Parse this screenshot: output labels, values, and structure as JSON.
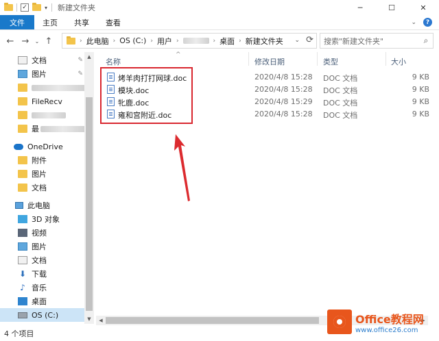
{
  "window": {
    "title": "新建文件夹",
    "minimize": "─",
    "maximize": "☐",
    "close": "✕"
  },
  "ribbon": {
    "tabs": [
      "文件",
      "主页",
      "共享",
      "查看"
    ],
    "expand": "⌄",
    "help": "?"
  },
  "nav": {
    "back": "←",
    "forward": "→",
    "recent": "⌄",
    "up": "↑",
    "breadcrumb": [
      "此电脑",
      "OS (C:)",
      "用户",
      "桌面",
      "新建文件夹"
    ],
    "refresh": "⟳",
    "search_placeholder": "搜索\"新建文件夹\"",
    "search_icon": "⌕"
  },
  "sidebar": {
    "quick_access": [
      {
        "label": "文档",
        "icon": "documents-icon",
        "pinned": true
      },
      {
        "label": "图片",
        "icon": "pictures-icon",
        "pinned": true
      },
      {
        "label": "",
        "icon": "folder-icon",
        "blurred": true
      },
      {
        "label": "FileRecv",
        "icon": "folder-icon"
      },
      {
        "label": "",
        "icon": "folder-icon",
        "blurred": true
      },
      {
        "label": "最",
        "icon": "folder-icon",
        "blurred": true
      }
    ],
    "onedrive": {
      "label": "OneDrive",
      "items": [
        "附件",
        "图片",
        "文档"
      ]
    },
    "this_pc": {
      "label": "此电脑",
      "items": [
        "3D 对象",
        "视频",
        "图片",
        "文档",
        "下载",
        "音乐",
        "桌面",
        "OS (C:)"
      ]
    },
    "pin_glyph": "📌"
  },
  "columns": {
    "name": "名称",
    "date": "修改日期",
    "type": "类型",
    "size": "大小",
    "sort_indicator": "^"
  },
  "files": [
    {
      "name": "烤羊肉打打网球.doc",
      "date": "2020/4/8 15:28",
      "type": "DOC 文档",
      "size": "9 KB"
    },
    {
      "name": "模块.doc",
      "date": "2020/4/8 15:28",
      "type": "DOC 文档",
      "size": "9 KB"
    },
    {
      "name": "牝鹿.doc",
      "date": "2020/4/8 15:29",
      "type": "DOC 文档",
      "size": "9 KB"
    },
    {
      "name": "雍和宫附近.doc",
      "date": "2020/4/8 15:28",
      "type": "DOC 文档",
      "size": "9 KB"
    }
  ],
  "status": {
    "count": "4 个项目"
  },
  "watermark": {
    "main": "Office教程网",
    "sub": "www.office26.com"
  },
  "colors": {
    "file_tab": "#1979ca",
    "highlight": "#d9262e",
    "watermark": "#e8561c"
  }
}
